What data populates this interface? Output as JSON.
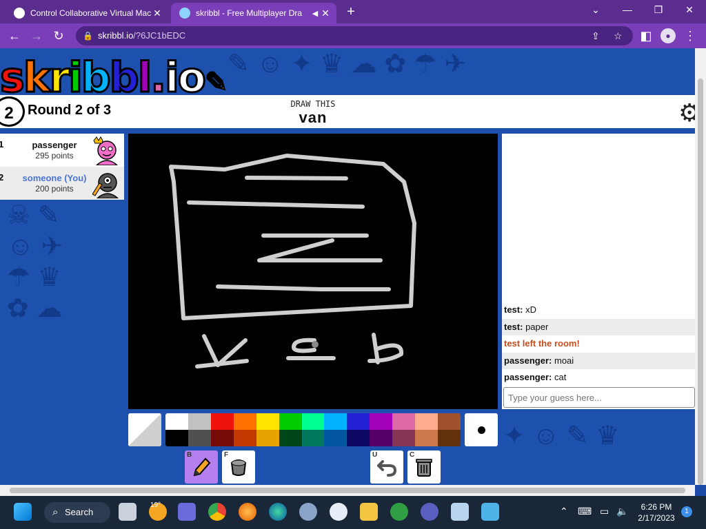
{
  "browser": {
    "tabs": [
      {
        "title": "Control Collaborative Virtual Mac",
        "active": false
      },
      {
        "title": "skribbl - Free Multiplayer Dra",
        "active": true
      }
    ],
    "new_tab": "+",
    "url_host": "skribbl.io",
    "url_rest": "/?6JC1bEDC",
    "window_controls": [
      "⌄",
      "—",
      "❐",
      "✕"
    ]
  },
  "game": {
    "logo_text": "skribbl.io",
    "round_number": "2",
    "round_label": "Round 2 of 3",
    "draw_this_label": "DRAW THIS",
    "word": "van",
    "players": [
      {
        "rank": "1",
        "name": "passenger",
        "points": "295 points",
        "name_color": "#111111",
        "avatar_color": "#f06ec8",
        "is_owner": true
      },
      {
        "rank": "2",
        "name": "someone (You)",
        "points": "200 points",
        "name_color": "#4a74d6",
        "avatar_color": "#555555",
        "is_drawing": true
      }
    ],
    "chat": [
      {
        "user": "test:",
        "text": "xD",
        "type": "message"
      },
      {
        "user": "test:",
        "text": "paper",
        "type": "message"
      },
      {
        "user": "",
        "text": "test left the room!",
        "type": "leave"
      },
      {
        "user": "passenger:",
        "text": "moai",
        "type": "message"
      },
      {
        "user": "passenger:",
        "text": "cat",
        "type": "message"
      }
    ],
    "guess_placeholder": "Type your guess here...",
    "palette_top": [
      "#ffffff",
      "#c1c1c1",
      "#ef130b",
      "#ff7100",
      "#ffe400",
      "#00cc00",
      "#00ff91",
      "#00b2ff",
      "#231fd3",
      "#a300ba",
      "#df69a7",
      "#ffac8e",
      "#a0522d"
    ],
    "palette_bottom": [
      "#000000",
      "#505050",
      "#740b07",
      "#c23800",
      "#e8a200",
      "#004619",
      "#00785d",
      "#00569e",
      "#0e0865",
      "#550069",
      "#873554",
      "#cc774d",
      "#63300d"
    ],
    "tools": [
      {
        "key": "B",
        "name": "brush",
        "selected": true
      },
      {
        "key": "F",
        "name": "fill",
        "selected": false
      },
      {
        "key": "U",
        "name": "undo",
        "selected": false
      },
      {
        "key": "C",
        "name": "clear",
        "selected": false
      }
    ]
  },
  "taskbar": {
    "search_label": "Search",
    "weather_temp": "19°",
    "time": "6:26 PM",
    "date": "2/17/2023",
    "notification_count": "1"
  }
}
